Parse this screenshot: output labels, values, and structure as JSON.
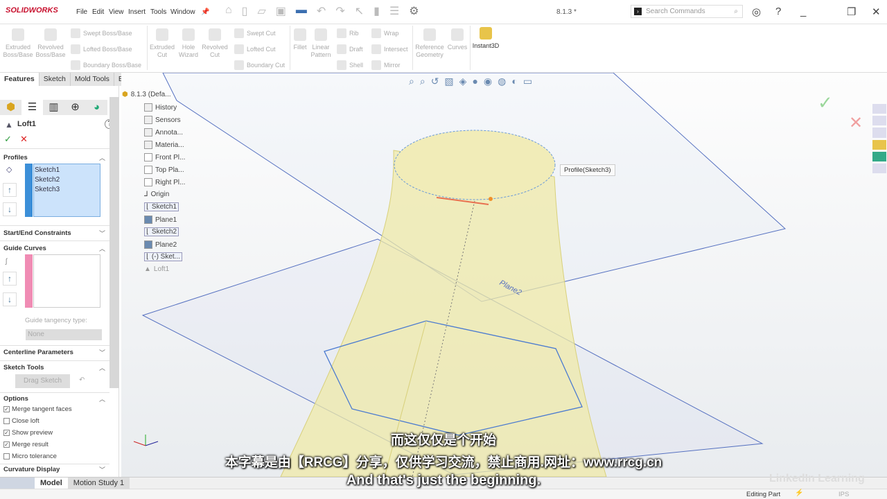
{
  "app": {
    "brand": "SOLIDWORKS",
    "doc_title": "8.1.3 *"
  },
  "menu": [
    "File",
    "Edit",
    "View",
    "Insert",
    "Tools",
    "Window"
  ],
  "search": {
    "placeholder": "Search Commands"
  },
  "commands": {
    "large": [
      {
        "label": "Extruded\nBoss/Base"
      },
      {
        "label": "Revolved\nBoss/Base"
      },
      {
        "label": "Extruded\nCut"
      },
      {
        "label": "Hole\nWizard"
      },
      {
        "label": "Revolved\nCut"
      },
      {
        "label": "Fillet"
      },
      {
        "label": "Linear\nPattern"
      },
      {
        "label": "Reference\nGeometry"
      },
      {
        "label": "Curves"
      },
      {
        "label": "Instant3D"
      }
    ],
    "small": [
      "Swept Boss/Base",
      "Lofted Boss/Base",
      "Boundary Boss/Base",
      "Swept Cut",
      "Lofted Cut",
      "Boundary Cut",
      "Rib",
      "Draft",
      "Shell",
      "Wrap",
      "Intersect",
      "Mirror"
    ]
  },
  "tabs": [
    "Features",
    "Sketch",
    "Mold Tools",
    "Evaluate"
  ],
  "property_manager": {
    "title": "Loft1",
    "sections": {
      "profiles": "Profiles",
      "start_end": "Start/End Constraints",
      "guide_curves": "Guide Curves",
      "centerline": "Centerline Parameters",
      "sketch_tools": "Sketch Tools",
      "options": "Options",
      "curvature": "Curvature Display"
    },
    "profiles": [
      "Sketch1",
      "Sketch2",
      "Sketch3"
    ],
    "guide_tangency_label": "Guide tangency type:",
    "guide_tangency_value": "None",
    "drag_sketch": "Drag Sketch",
    "options": [
      {
        "label": "Merge tangent faces",
        "checked": true
      },
      {
        "label": "Close loft",
        "checked": false
      },
      {
        "label": "Show preview",
        "checked": true
      },
      {
        "label": "Merge result",
        "checked": true
      },
      {
        "label": "Micro tolerance",
        "checked": false
      }
    ]
  },
  "tree": [
    "8.1.3 (Defa...",
    "History",
    "Sensors",
    "Annota...",
    "Materia...",
    "Front Pl...",
    "Top Pla...",
    "Right Pl...",
    "Origin",
    "Sketch1",
    "Plane1",
    "Sketch2",
    "Plane2",
    "(-) Sket...",
    "Loft1"
  ],
  "viewport": {
    "tooltip": "Profile(Sketch3)",
    "plane_label": "Plane2"
  },
  "bottom_tabs": [
    "Model",
    "Motion Study 1"
  ],
  "status": {
    "mode": "Editing Part",
    "units": "IPS"
  },
  "subtitles": {
    "zh1": "而这仅仅是个开始",
    "zh2": "本字幕是由【RRCG】分享，仅供学习交流，禁止商用.网址：www.rrcg.cn",
    "en": "And that's just the beginning."
  },
  "watermark": "LinkedIn Learning",
  "colors": {
    "accent": "#3c8fd8",
    "loft_fill": "#efe9a8",
    "plane": "#5570c0"
  }
}
